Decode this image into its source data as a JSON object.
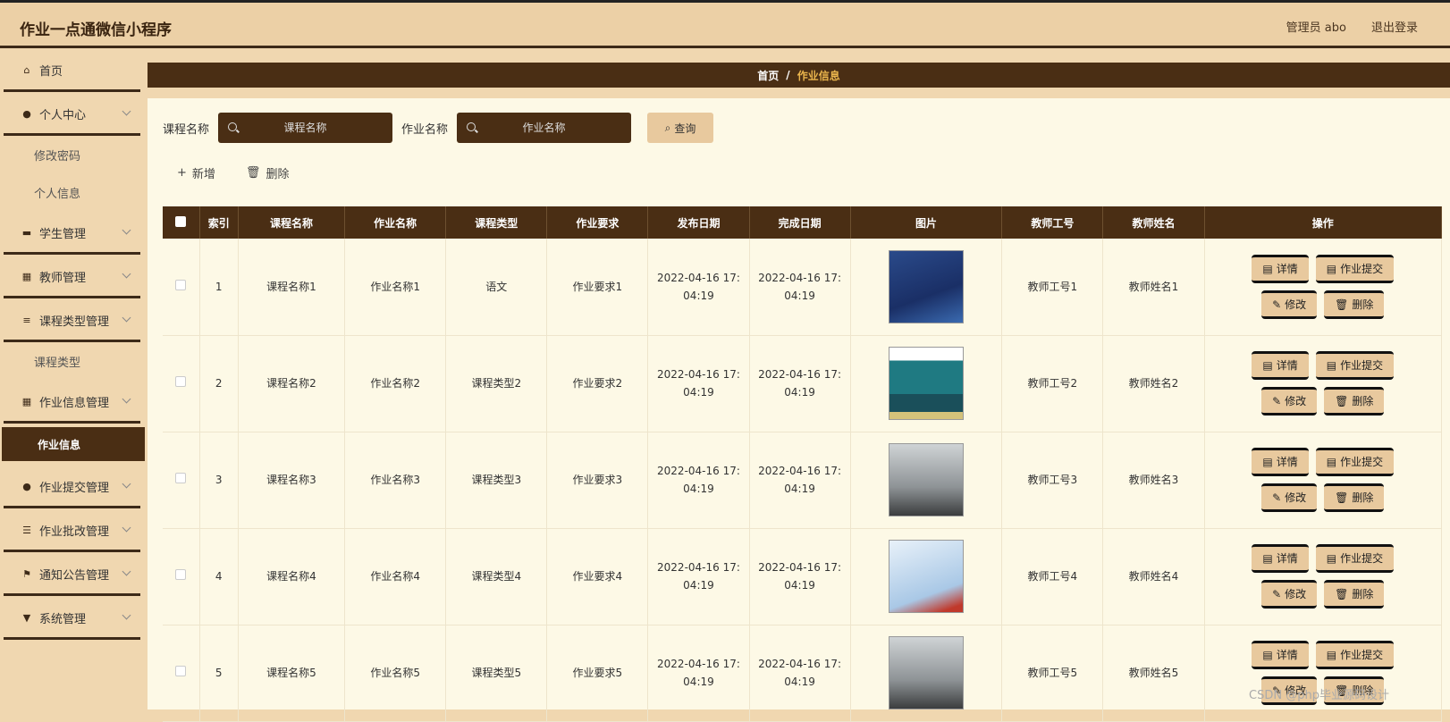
{
  "header": {
    "title": "作业一点通微信小程序",
    "user": "管理员 abo",
    "logout": "退出登录"
  },
  "sidebar": {
    "items": [
      {
        "label": "首页",
        "icon": "home-icon",
        "chev": false
      },
      {
        "label": "个人中心",
        "icon": "user-icon",
        "chev": true
      },
      {
        "label": "学生管理",
        "icon": "briefcase-icon",
        "chev": true
      },
      {
        "label": "教师管理",
        "icon": "grid-icon",
        "chev": true
      },
      {
        "label": "课程类型管理",
        "icon": "list-icon",
        "chev": true
      },
      {
        "label": "作业信息管理",
        "icon": "grid-icon",
        "chev": true
      },
      {
        "label": "作业提交管理",
        "icon": "user-icon",
        "chev": true
      },
      {
        "label": "作业批改管理",
        "icon": "sliders-icon",
        "chev": true
      },
      {
        "label": "通知公告管理",
        "icon": "flag-icon",
        "chev": true
      },
      {
        "label": "系统管理",
        "icon": "sign-icon",
        "chev": true
      }
    ],
    "sub_personal": [
      "修改密码",
      "个人信息"
    ],
    "sub_course_type": [
      "课程类型"
    ],
    "sub_homework": [
      "作业信息"
    ]
  },
  "breadcrumb": {
    "home": "首页",
    "sep": "/",
    "current": "作业信息"
  },
  "search": {
    "course_label": "课程名称",
    "course_placeholder": "课程名称",
    "homework_label": "作业名称",
    "homework_placeholder": "作业名称",
    "query": "查询"
  },
  "actions": {
    "add": "新增",
    "delete": "删除"
  },
  "table": {
    "headers": [
      "索引",
      "课程名称",
      "作业名称",
      "课程类型",
      "作业要求",
      "发布日期",
      "完成日期",
      "图片",
      "教师工号",
      "教师姓名",
      "操作"
    ],
    "rows": [
      {
        "idx": "1",
        "course": "课程名称1",
        "homework": "作业名称1",
        "type": "语文",
        "req": "作业要求1",
        "pub": "2022-04-16 17:04:19",
        "done": "2022-04-16 17:04:19",
        "tid": "教师工号1",
        "tname": "教师姓名1"
      },
      {
        "idx": "2",
        "course": "课程名称2",
        "homework": "作业名称2",
        "type": "课程类型2",
        "req": "作业要求2",
        "pub": "2022-04-16 17:04:19",
        "done": "2022-04-16 17:04:19",
        "tid": "教师工号2",
        "tname": "教师姓名2"
      },
      {
        "idx": "3",
        "course": "课程名称3",
        "homework": "作业名称3",
        "type": "课程类型3",
        "req": "作业要求3",
        "pub": "2022-04-16 17:04:19",
        "done": "2022-04-16 17:04:19",
        "tid": "教师工号3",
        "tname": "教师姓名3"
      },
      {
        "idx": "4",
        "course": "课程名称4",
        "homework": "作业名称4",
        "type": "课程类型4",
        "req": "作业要求4",
        "pub": "2022-04-16 17:04:19",
        "done": "2022-04-16 17:04:19",
        "tid": "教师工号4",
        "tname": "教师姓名4"
      },
      {
        "idx": "5",
        "course": "课程名称5",
        "homework": "作业名称5",
        "type": "课程类型5",
        "req": "作业要求5",
        "pub": "2022-04-16 17:04:19",
        "done": "2022-04-16 17:04:19",
        "tid": "教师工号5",
        "tname": "教师姓名5"
      }
    ],
    "btn_detail": "详情",
    "btn_submit": "作业提交",
    "btn_edit": "修改",
    "btn_delete": "删除"
  },
  "watermark": "CSDN @php毕业源码设计"
}
